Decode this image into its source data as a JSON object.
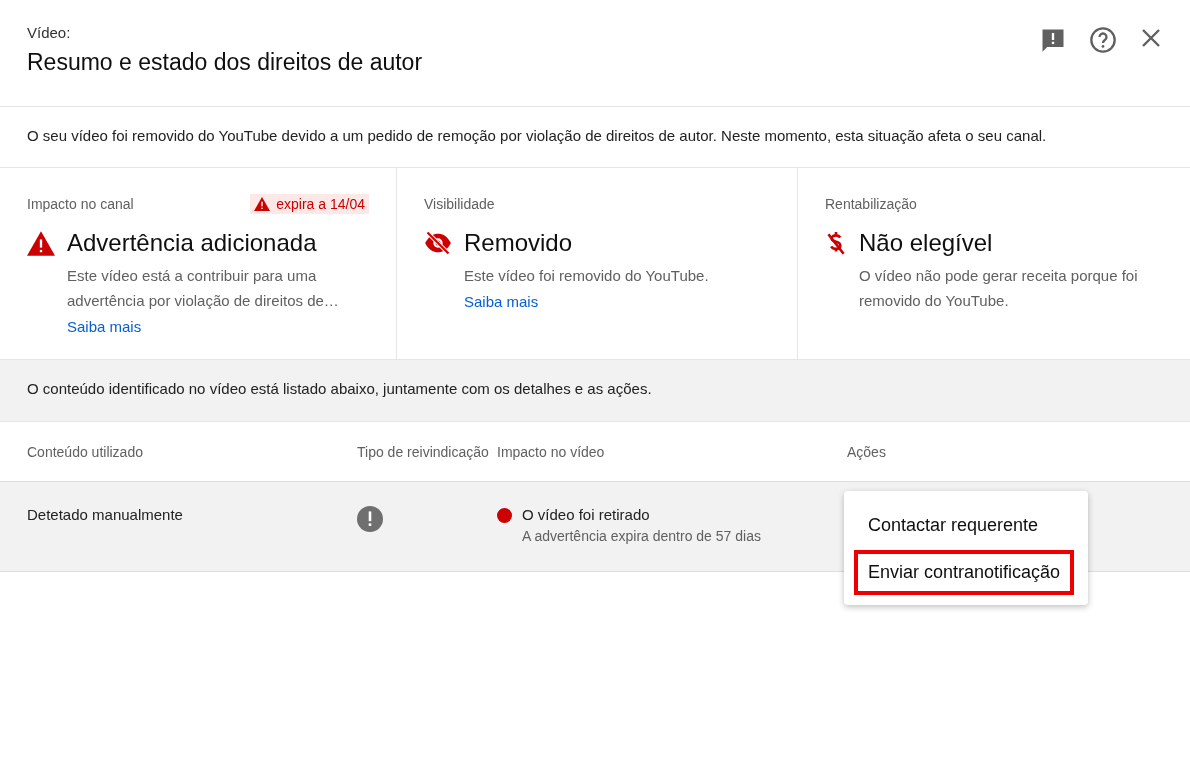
{
  "header": {
    "subtitle": "Vídeo:",
    "title": "Resumo e estado dos direitos de autor"
  },
  "notice": "O seu vídeo foi removido do YouTube devido a um pedido de remoção por violação de direitos de autor. Neste momento, esta situação afeta o seu canal.",
  "cards": [
    {
      "kind": "warning",
      "label": "Impacto no canal",
      "badge": "expira a 14/04",
      "title": "Advertência adicionada",
      "description": "Este vídeo está a contribuir para uma advertência por violação de direitos de…",
      "link": "Saiba mais"
    },
    {
      "kind": "hidden",
      "label": "Visibilidade",
      "title": "Removido",
      "description": "Este vídeo foi removido do YouTube.",
      "link": "Saiba mais"
    },
    {
      "kind": "money",
      "label": "Rentabilização",
      "title": "Não elegível",
      "description": "O vídeo não pode gerar receita porque foi removido do YouTube."
    }
  ],
  "info": "O conteúdo identificado no vídeo está listado abaixo, juntamente com os detalhes e as ações.",
  "table": {
    "columns": [
      "Conteúdo utilizado",
      "Tipo de reivindicação",
      "Impacto no vídeo",
      "Ações"
    ],
    "rows": [
      {
        "content": "Detetado manualmente",
        "impact": "O vídeo foi retirado",
        "impact_detail": "A advertência expira dentro de 57 dias",
        "color": "#cc0000"
      }
    ]
  },
  "menu": [
    {
      "label": "Contactar requerente",
      "highlighted": false
    },
    {
      "label": "Enviar contranotificação",
      "highlighted": true
    }
  ]
}
